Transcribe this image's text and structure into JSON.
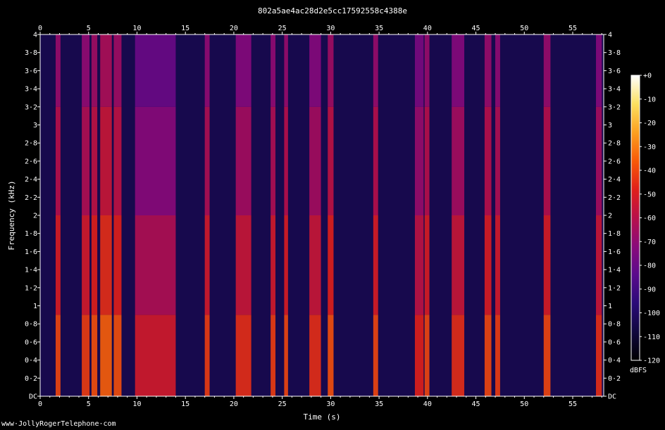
{
  "chart_data": {
    "type": "heatmap",
    "title": "802a5ae4ac28d2e5cc17592558c4388e",
    "xlabel": "Time (s)",
    "ylabel": "Frequency (kHz)",
    "xlim": [
      0,
      58.2
    ],
    "ylim": [
      0,
      4
    ],
    "x_ticks": [
      "0",
      "5",
      "10",
      "15",
      "20",
      "25",
      "30",
      "35",
      "40",
      "45",
      "50",
      "55"
    ],
    "x_tick_values": [
      0,
      5,
      10,
      15,
      20,
      25,
      30,
      35,
      40,
      45,
      50,
      55
    ],
    "y_ticks": [
      "DC",
      "0·2",
      "0·4",
      "0·6",
      "0·8",
      "1",
      "1·2",
      "1·4",
      "1·6",
      "1·8",
      "2",
      "2·2",
      "2·4",
      "2·6",
      "2·8",
      "3",
      "3·2",
      "3·4",
      "3·6",
      "3·8",
      "4"
    ],
    "y_tick_values": [
      0,
      0.2,
      0.4,
      0.6,
      0.8,
      1,
      1.2,
      1.4,
      1.6,
      1.8,
      2,
      2.2,
      2.4,
      2.6,
      2.8,
      3,
      3.2,
      3.4,
      3.6,
      3.8,
      4
    ],
    "colorbar": {
      "label": "dBFS",
      "range": [
        -120,
        0
      ],
      "ticks": [
        "+0",
        "-10",
        "-20",
        "-30",
        "-40",
        "-50",
        "-60",
        "-70",
        "-80",
        "-90",
        "-100",
        "-110",
        "-120"
      ],
      "tick_values": [
        0,
        -10,
        -20,
        -30,
        -40,
        -50,
        -60,
        -70,
        -80,
        -90,
        -100,
        -110,
        -120
      ],
      "colormap": [
        "#000000",
        "#10083e",
        "#2a0a78",
        "#5a0a8c",
        "#8a0a7a",
        "#b8104a",
        "#e0201a",
        "#f85a08",
        "#fca020",
        "#fce060",
        "#ffffff"
      ]
    },
    "background_level_dbfs": -105,
    "bursts": [
      {
        "t0": 1.6,
        "t1": 2.1,
        "level": -40
      },
      {
        "t0": 4.3,
        "t1": 5.1,
        "level": -42
      },
      {
        "t0": 5.3,
        "t1": 5.9,
        "level": -38
      },
      {
        "t0": 6.2,
        "t1": 7.4,
        "level": -35
      },
      {
        "t0": 7.6,
        "t1": 8.4,
        "level": -38
      },
      {
        "t0": 9.8,
        "t1": 14.0,
        "level": -52
      },
      {
        "t0": 17.0,
        "t1": 17.5,
        "level": -42
      },
      {
        "t0": 20.2,
        "t1": 21.8,
        "level": -45
      },
      {
        "t0": 23.8,
        "t1": 24.3,
        "level": -42
      },
      {
        "t0": 25.2,
        "t1": 25.6,
        "level": -40
      },
      {
        "t0": 27.8,
        "t1": 29.0,
        "level": -45
      },
      {
        "t0": 29.7,
        "t1": 30.3,
        "level": -38
      },
      {
        "t0": 34.4,
        "t1": 34.9,
        "level": -40
      },
      {
        "t0": 38.7,
        "t1": 39.6,
        "level": -48
      },
      {
        "t0": 39.7,
        "t1": 40.2,
        "level": -40
      },
      {
        "t0": 42.5,
        "t1": 43.8,
        "level": -45
      },
      {
        "t0": 45.9,
        "t1": 46.6,
        "level": -40
      },
      {
        "t0": 47.0,
        "t1": 47.5,
        "level": -42
      },
      {
        "t0": 52.0,
        "t1": 52.7,
        "level": -40
      },
      {
        "t0": 57.4,
        "t1": 58.0,
        "level": -45
      }
    ]
  },
  "footer": "www·JollyRogerTelephone·com"
}
